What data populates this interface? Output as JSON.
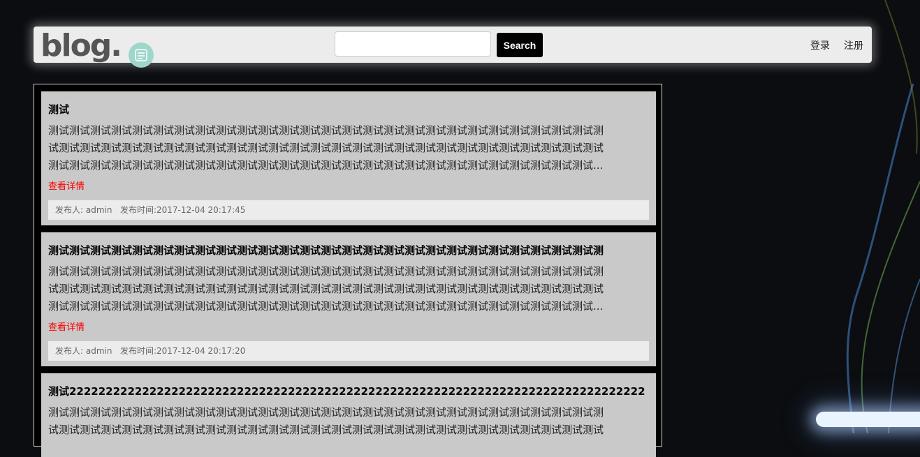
{
  "header": {
    "logo_text": "blog.",
    "search": {
      "placeholder": "",
      "button_label": "Search"
    },
    "nav": {
      "login": "登录",
      "register": "注册"
    }
  },
  "posts": [
    {
      "title": "测试",
      "body_lines": [
        "测试测试测试测试测试测试测试测试测试测试测试测试测试测试测试测试测试测试测试测试测试测试测试测试测试测试测",
        "试测试测试测试测试测试测试测试测试测试测试测试测试测试测试测试测试测试测试测试测试测试测试测试测试测试测试",
        "测试测试测试测试测试测试测试测试测试测试测试测试测试测试测试测试测试测试测试测试测试测试测试测试测试测试..."
      ],
      "more_label": "查看详情",
      "author_label": "发布人:",
      "author": "admin",
      "time_label": "发布时间:",
      "time": "2017-12-04 20:17:45"
    },
    {
      "title": "测试测试测试测试测试测试测试测试测试测试测试测试测试测试测试测试测试测试测试测试测试测试测试测试测试测试测",
      "body_lines": [
        "测试测试测试测试测试测试测试测试测试测试测试测试测试测试测试测试测试测试测试测试测试测试测试测试测试测试测",
        "试测试测试测试测试测试测试测试测试测试测试测试测试测试测试测试测试测试测试测试测试测试测试测试测试测试测试",
        "测试测试测试测试测试测试测试测试测试测试测试测试测试测试测试测试测试测试测试测试测试测试测试测试测试测试..."
      ],
      "more_label": "查看详情",
      "author_label": "发布人:",
      "author": "admin",
      "time_label": "发布时间:",
      "time": "2017-12-04 20:17:20"
    },
    {
      "title": "测试2222222222222222222222222222222222222222222222222222222222222222222222222222222",
      "body_lines": [
        "测试测试测试测试测试测试测试测试测试测试测试测试测试测试测试测试测试测试测试测试测试测试测试测试测试测试测",
        "试测试测试测试测试测试测试测试测试测试测试测试测试测试测试测试测试测试测试测试测试测试测试测试测试测试测试"
      ]
    }
  ]
}
